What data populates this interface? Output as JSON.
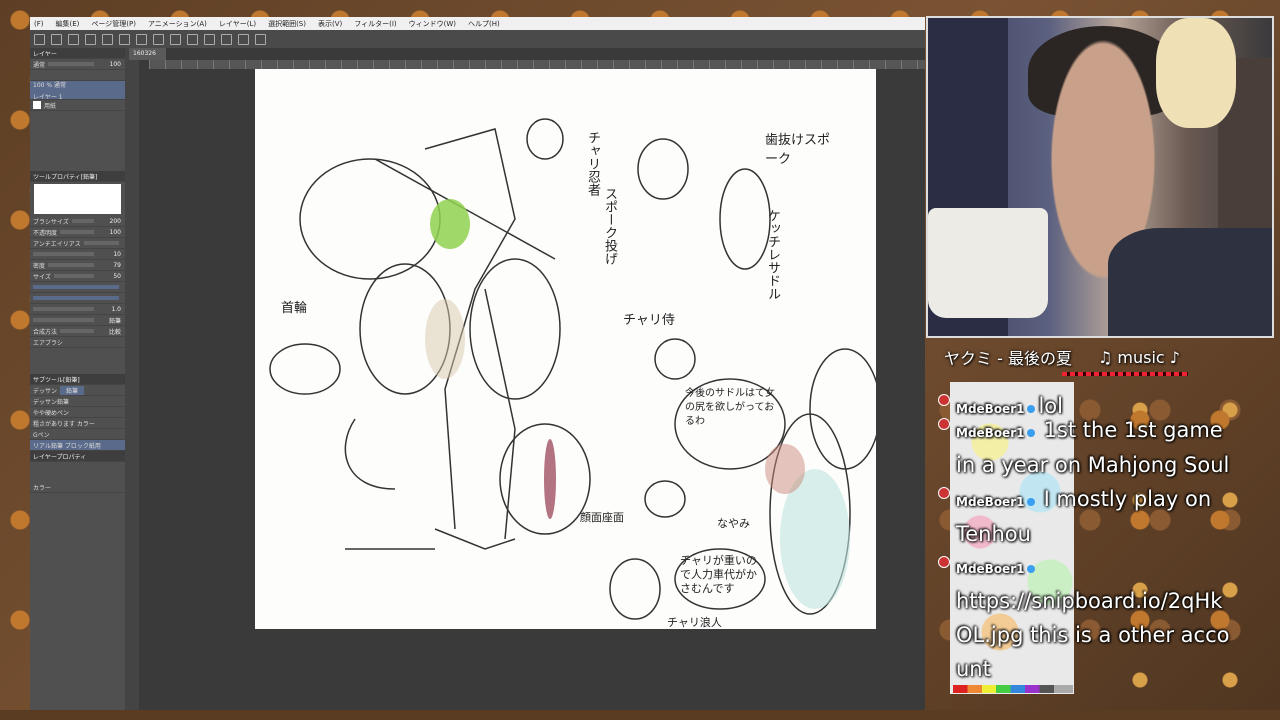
{
  "app": {
    "menu": [
      "(F)",
      "編集(E)",
      "ページ管理(P)",
      "アニメーション(A)",
      "レイヤー(L)",
      "選択範囲(S)",
      "表示(V)",
      "フィルター(I)",
      "ウィンドウ(W)",
      "ヘルプ(H)"
    ],
    "document_tab": "160326"
  },
  "left_panel": {
    "layer_header": "レイヤー",
    "blend_mode": "通常",
    "layer_opacity": "100",
    "layer1_name": "100 % 通常",
    "layer1_sub": "レイヤー 1",
    "paper_layer": "用紙",
    "tool_property_header": "ツールプロパティ[鉛筆]",
    "brush_size_label": "ブラシサイズ",
    "brush_size_value": "200",
    "opacity_label": "不透明度",
    "opacity_value": "100",
    "aa_label": "アンチエイリアス",
    "hardness_value": "10",
    "density_label": "密度",
    "density_value": "79",
    "size_label": "サイズ",
    "size_value": "50",
    "value_1_0": "1.0",
    "pen_mode": "鉛筆",
    "blend_method_label": "合成方法",
    "blend_method_value": "比較",
    "brush_label": "エアブラシ",
    "subtool_header": "サブツール[鉛筆]",
    "subtool_tab_a": "デッサン",
    "subtool_tab_b": "鉛筆",
    "subtool_items": [
      "デッサン鉛筆",
      "やや硬めペン",
      "粗さがあります カラー",
      "Gペン",
      "リアル鉛筆 ブロック紙用"
    ],
    "layer_property_header": "レイヤープロパティ",
    "color_label": "カラー"
  },
  "canvas_text": {
    "chari_ninja": "チャリ忍者",
    "spoke_throw": "スポーク投げ",
    "tooth_spoke": "歯抜けスポーク",
    "kettsu_saddle": "ケッチレサドル",
    "kubiwa": "首輪",
    "chari_samurai": "チャリ侍",
    "speech1": "今後のサドルはて女の尻を欲しがっておるわ",
    "face_seat": "顔面座面",
    "nayami": "なやみ",
    "speech2": "チャリが重いので人力車代がかさむんです",
    "chari_ronin": "チャリ浪人"
  },
  "now_playing": {
    "title": "ヤクミ - 最後の夏",
    "label": "♫ music ♪"
  },
  "chat": {
    "messages": [
      {
        "user": "MdeBoer1",
        "text": "lol"
      },
      {
        "user": "MdeBoer1",
        "text": "1st the 1st game in a year on Mahjong Soul"
      },
      {
        "user": "MdeBoer1",
        "text": "I mostly play on Tenhou"
      },
      {
        "user": "MdeBoer1",
        "text": "https://snipboard.io/2qHkOL.jpg this is a other account"
      }
    ]
  },
  "colors": {
    "badge": "#cc3333",
    "verified_dot": "#3a9ff0",
    "accent_green": "#8fd14f"
  }
}
